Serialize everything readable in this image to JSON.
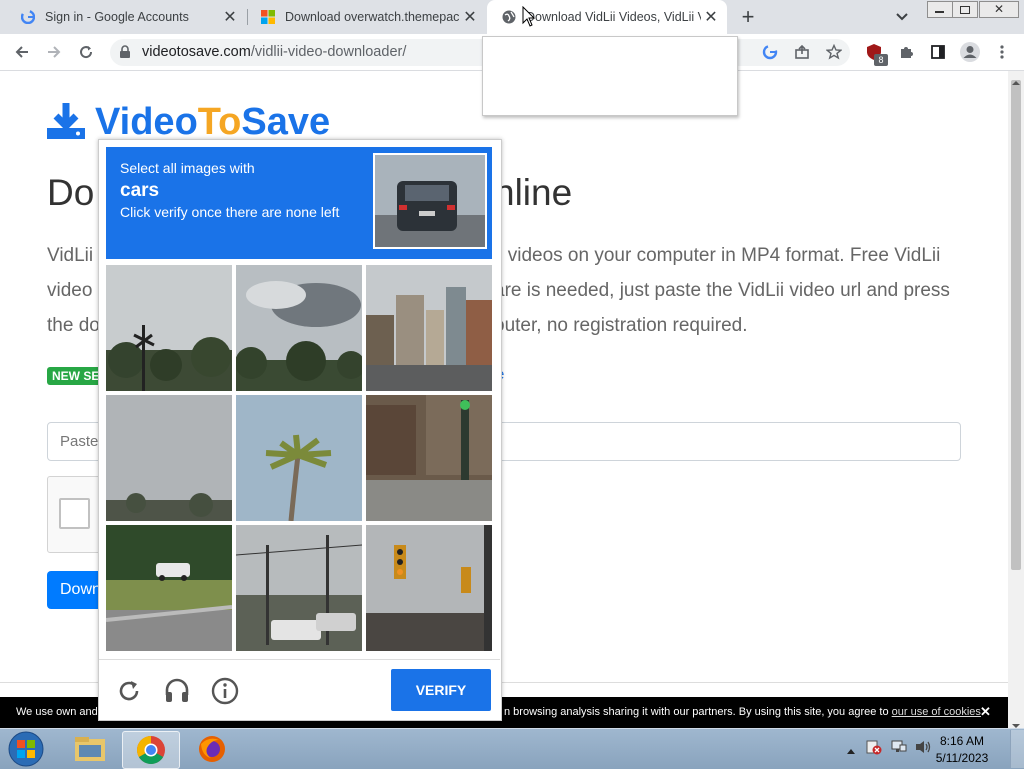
{
  "browser": {
    "tabs": [
      {
        "title": "Sign in - Google Accounts",
        "favicon": "google-icon"
      },
      {
        "title": "Download overwatch.themepack",
        "favicon": "windows-icon"
      },
      {
        "title": "Download VidLii Videos, VidLii V",
        "favicon": "globe-icon"
      }
    ],
    "new_tab": "+",
    "close_tab": "✕",
    "url_domain": "videotosave.com",
    "url_path": "/vidlii-video-downloader/",
    "ext_badge": "8"
  },
  "page": {
    "brand": {
      "part1": "Video",
      "part2": "To",
      "part3": "Save"
    },
    "heading_left": "Do",
    "heading_right": "nline",
    "para_left_1": "VidLii",
    "para_left_2": "video",
    "para_left_3": "the do",
    "para_right_1": "ii videos on your computer in MP4 format. Free VidLii",
    "para_right_2": "are is needed, just paste the VidLii video url and press",
    "para_right_3": "outer, no registration required.",
    "badge": "NEW SE",
    "link_right": "e",
    "input_placeholder": "Paste",
    "download_btn": "Down"
  },
  "cookie": {
    "left": "We use own and",
    "right": "n browsing analysis sharing it with our partners. By using this site, you agree to",
    "link": "our use of cookies",
    "tail": ".",
    "close": "✕"
  },
  "captcha": {
    "line1": "Select all images with",
    "target": "cars",
    "line2": "Click verify once there are none left",
    "verify": "VERIFY",
    "tiles": [
      "tile-trees-sky",
      "tile-clouds-trees",
      "tile-city-street",
      "tile-overcast-sky",
      "tile-palm-tree",
      "tile-street-traffic-light",
      "tile-highway-truck",
      "tile-street-cars",
      "tile-traffic-lights"
    ]
  },
  "taskbar": {
    "time": "8:16 AM",
    "date": "5/11/2023"
  },
  "colors": {
    "accent": "#1a73e8",
    "brand_orange": "#f5a623",
    "badge_green": "#28a745"
  }
}
